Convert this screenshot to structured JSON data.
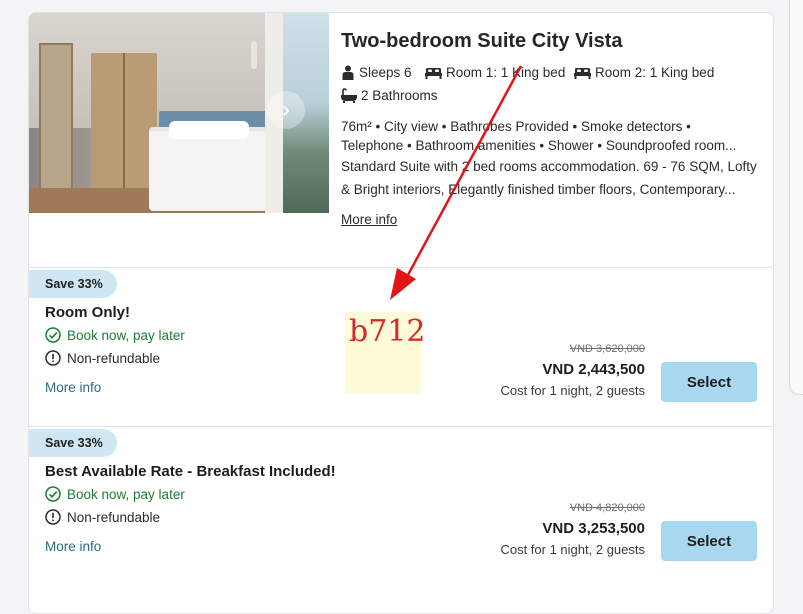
{
  "colors": {
    "badge_bg": "#cfe6f3",
    "select_bg": "#a8d8ef",
    "policy_green": "#1f7a3a",
    "link": "#2c6b80",
    "annotation_red": "#e01616"
  },
  "room": {
    "title": "Two-bedroom Suite City Vista",
    "features": [
      {
        "icon": "person-icon",
        "text": "Sleeps 6"
      },
      {
        "icon": "bed-icon",
        "text": "Room 1: 1 King bed"
      },
      {
        "icon": "bed-icon",
        "text": "Room 2: 1 King bed"
      },
      {
        "icon": "bathtub-icon",
        "text": "2 Bathrooms"
      }
    ],
    "amenities_line1": "76m² •  City view •  Bathrobes Provided •  Smoke detectors •",
    "amenities_line2": "Telephone •  Bathroom amenities •  Shower •  Soundproofed room...",
    "description_line1": "Standard Suite with 2 bed rooms accommodation. 69 - 76 SQM, Lofty",
    "description_line2": "& Bright interiors, Elegantly finished timber floors, Contemporary...",
    "more_info": "More info"
  },
  "rates": [
    {
      "badge": "Save 33%",
      "name": "Room Only!",
      "policy_pay": "Book now, pay later",
      "policy_refund": "Non-refundable",
      "more_info": "More info",
      "old_price": "VND 3,620,000",
      "price": "VND 2,443,500",
      "cost_note": "Cost for 1 night, 2 guests",
      "select_label": "Select"
    },
    {
      "badge": "Save 33%",
      "name": "Best Available Rate - Breakfast Included!",
      "policy_pay": "Book now, pay later",
      "policy_refund": "Non-refundable",
      "more_info": "More info",
      "old_price": "VND 4,820,000",
      "price": "VND 3,253,500",
      "cost_note": "Cost for 1 night, 2 guests",
      "select_label": "Select"
    }
  ],
  "annotation": {
    "label": "b712"
  }
}
